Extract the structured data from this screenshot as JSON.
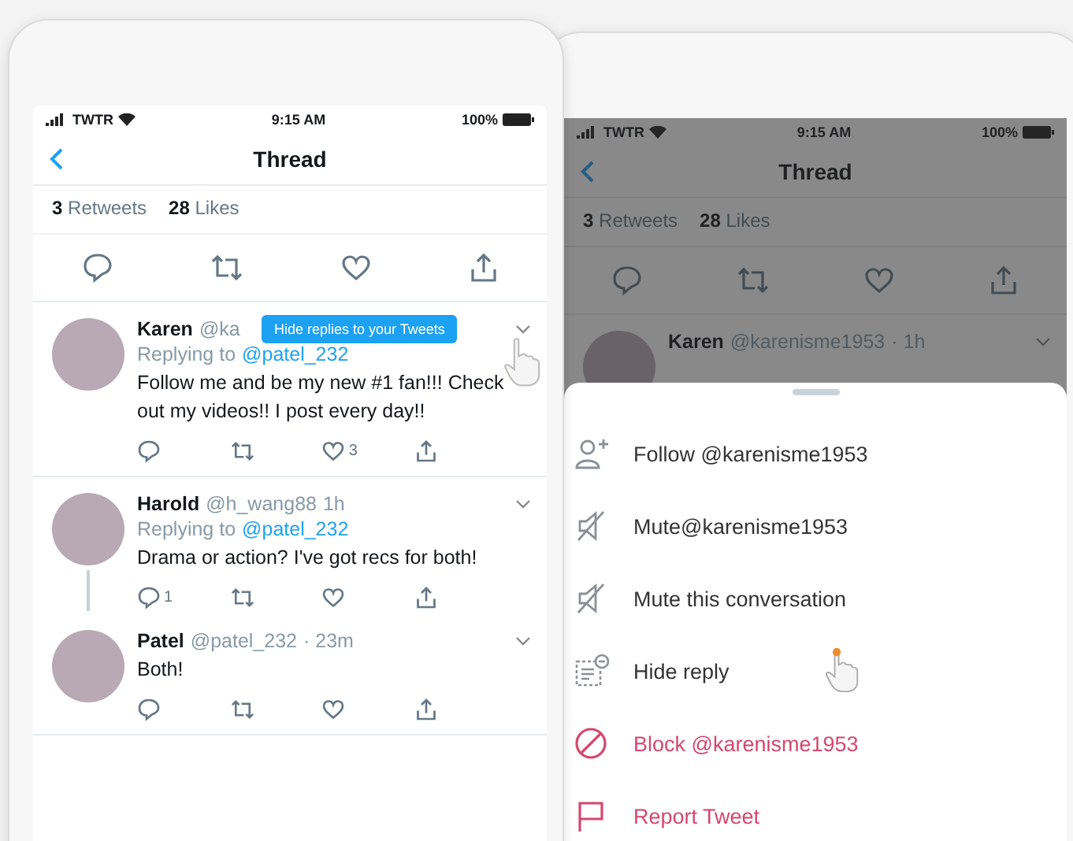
{
  "left_phone": {
    "status_bar": {
      "carrier": "TWTR",
      "time": "9:15 AM",
      "battery": "100%"
    },
    "title": "Thread",
    "stats": [
      {
        "count": "3",
        "label": "Retweets"
      },
      {
        "count": "28",
        "label": "Likes"
      }
    ],
    "actions": [
      {
        "kind": "reply"
      },
      {
        "kind": "retweet"
      },
      {
        "kind": "like"
      },
      {
        "kind": "share"
      }
    ],
    "tooltip": "Hide replies to your Tweets",
    "tweets": [
      {
        "name": "Karen",
        "handle": "@ka",
        "replying_prefix": "Replying to",
        "replying_to": "@patel_232",
        "text": "Follow me and be my new #1 fan!!! Check out my videos!! I post every day!!",
        "thread_line": false,
        "actions": [
          {
            "kind": "reply"
          },
          {
            "kind": "retweet"
          },
          {
            "kind": "like",
            "count": "3"
          },
          {
            "kind": "share"
          }
        ]
      },
      {
        "name": "Harold",
        "handle": "@h_wang88",
        "time": "1h",
        "replying_prefix": "Replying to",
        "replying_to": "@patel_232",
        "text": "Drama or action? I've got recs for both!",
        "thread_line": true,
        "actions": [
          {
            "kind": "reply",
            "count": "1"
          },
          {
            "kind": "retweet"
          },
          {
            "kind": "like"
          },
          {
            "kind": "share"
          }
        ]
      },
      {
        "name": "Patel",
        "handle": "@patel_232",
        "time": "· 23m",
        "text": "Both!",
        "thread_line": false,
        "actions": [
          {
            "kind": "reply"
          },
          {
            "kind": "retweet"
          },
          {
            "kind": "like"
          },
          {
            "kind": "share"
          }
        ]
      }
    ]
  },
  "right_phone": {
    "status_bar": {
      "carrier": "TWTR",
      "time": "9:15 AM",
      "battery": "100%"
    },
    "title": "Thread",
    "stats": [
      {
        "count": "3",
        "label": "Retweets"
      },
      {
        "count": "28",
        "label": "Likes"
      }
    ],
    "actions": [
      {
        "kind": "reply"
      },
      {
        "kind": "retweet"
      },
      {
        "kind": "like"
      },
      {
        "kind": "share"
      }
    ],
    "tweet": {
      "name": "Karen",
      "handle": "@karenisme1953",
      "time": "· 1h"
    },
    "menu": [
      {
        "kind": "follow",
        "label": "Follow @karenisme1953",
        "danger": false
      },
      {
        "kind": "mute",
        "label": "Mute@karenisme1953",
        "danger": false
      },
      {
        "kind": "mute",
        "label": "Mute this conversation",
        "danger": false
      },
      {
        "kind": "hide",
        "label": "Hide reply",
        "danger": false
      },
      {
        "kind": "block",
        "label": "Block @karenisme1953",
        "danger": true
      },
      {
        "kind": "report",
        "label": "Report Tweet",
        "danger": true
      }
    ]
  }
}
